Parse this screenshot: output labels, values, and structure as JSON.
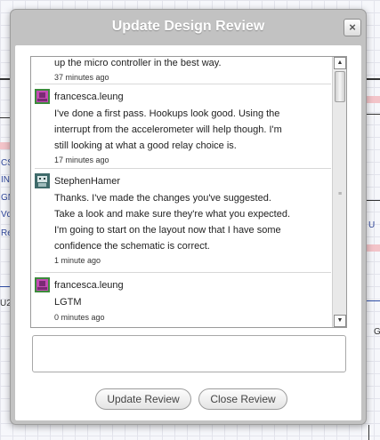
{
  "background": {
    "labels": [
      "CS",
      "INT",
      "GN",
      "Vd",
      "Re",
      "U2",
      "U",
      "G"
    ]
  },
  "dialog": {
    "title": "Update Design Review",
    "close_glyph": "×",
    "comments": [
      {
        "author": "",
        "lines": [
          "up the micro controller in the best way."
        ],
        "time": "37 minutes ago",
        "avatar": "none"
      },
      {
        "author": "francesca.leung",
        "lines": [
          "I've done a first pass. Hookups look good. Using the",
          "interrupt from the accelerometer will help though. I'm",
          "still looking at what a good relay choice is."
        ],
        "time": "17 minutes ago",
        "avatar": "avatar-pink-icon"
      },
      {
        "author": "StephenHamer",
        "lines": [
          "Thanks. I've made the changes you've suggested.",
          "Take a look and make sure they're what you expected.",
          "I'm going to start on the layout now that I have some",
          "confidence the schematic is correct."
        ],
        "time": "1 minute ago",
        "avatar": "avatar-robot-icon"
      },
      {
        "author": "francesca.leung",
        "lines": [
          "LGTM"
        ],
        "time": "0 minutes ago",
        "avatar": "avatar-pink-icon"
      }
    ],
    "reply": {
      "value": "",
      "placeholder": ""
    },
    "buttons": {
      "update": "Update Review",
      "close": "Close Review"
    }
  }
}
